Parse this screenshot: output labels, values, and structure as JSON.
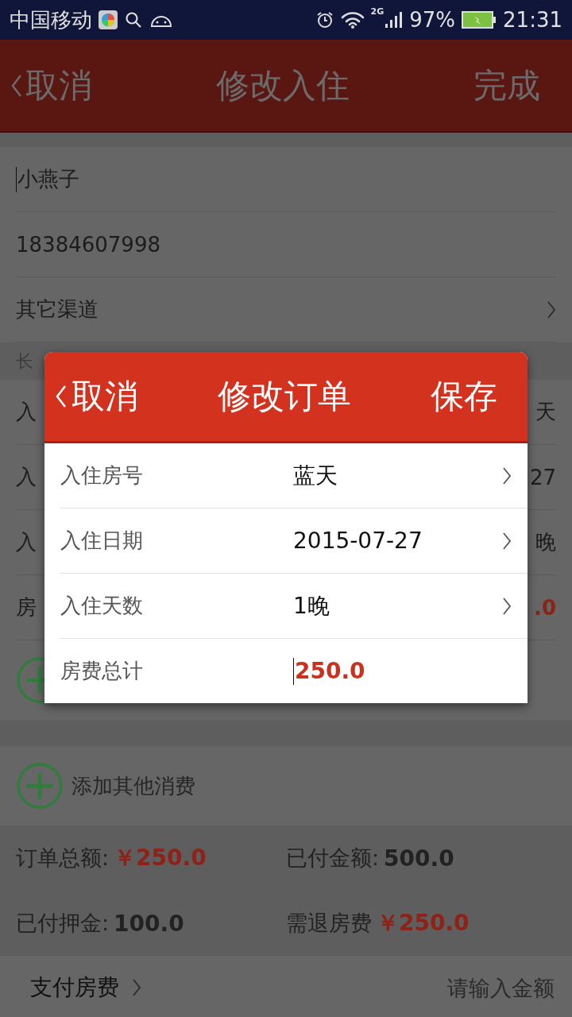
{
  "status_bar": {
    "carrier": "中国移动",
    "network": "2G",
    "battery": "97%",
    "time": "21:31"
  },
  "header": {
    "back": "取消",
    "title": "修改入住",
    "action": "完成"
  },
  "guest": {
    "name": "小燕子",
    "phone": "18384607998",
    "channel": "其它渠道"
  },
  "section_label": "长",
  "room_rows": [
    {
      "label": "入",
      "value": "天",
      "kind": "text"
    },
    {
      "label": "入",
      "value": "27",
      "kind": "text"
    },
    {
      "label": "入",
      "value": "晚",
      "kind": "text"
    },
    {
      "label": "房",
      "value": ".0",
      "kind": "amount"
    }
  ],
  "add_other": "添加其他消费",
  "totals": [
    {
      "label": "订单总额:",
      "value": "￥250.0",
      "highlight": true
    },
    {
      "label": "已付金额:",
      "value": "500.0",
      "highlight": false
    },
    {
      "label": "已付押金:",
      "value": "100.0",
      "highlight": false
    },
    {
      "label": "需退房费",
      "value": "￥250.0",
      "highlight": true
    }
  ],
  "pay": {
    "label": "支付房费",
    "placeholder": "请输入金额"
  },
  "dialog": {
    "back": "取消",
    "title": "修改订单",
    "save": "保存",
    "rows": [
      {
        "label": "入住房号",
        "value": "蓝天",
        "kind": "select"
      },
      {
        "label": "入住日期",
        "value": "2015-07-27",
        "kind": "select"
      },
      {
        "label": "入住天数",
        "value": "1晚",
        "kind": "select"
      },
      {
        "label": "房费总计",
        "value": "250.0",
        "kind": "input"
      }
    ]
  }
}
